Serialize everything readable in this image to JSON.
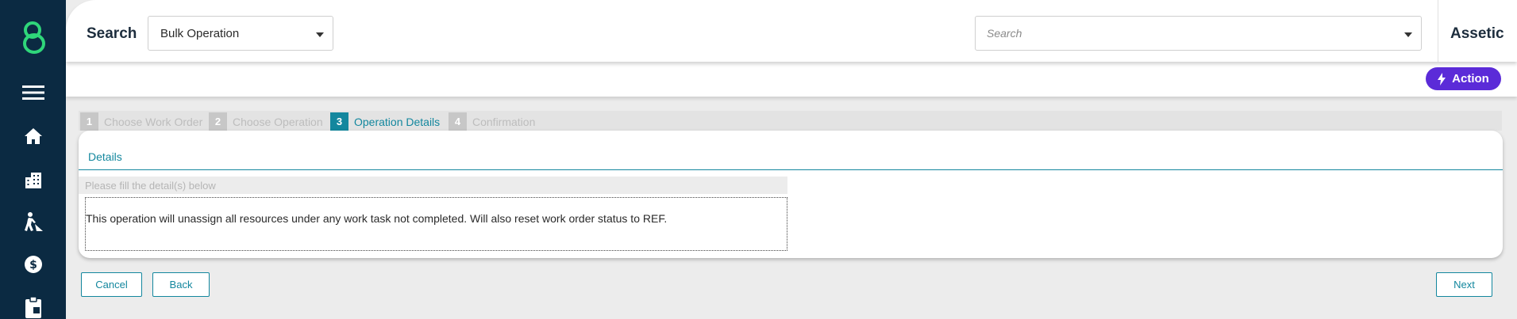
{
  "app": {
    "brand_name": "Assetic"
  },
  "header": {
    "title": "Search",
    "module_select": {
      "value": "Bulk Operation"
    },
    "search_select": {
      "placeholder": "Search"
    }
  },
  "sidebar": {
    "items": [
      {
        "icon": "menu-icon"
      },
      {
        "icon": "home-icon"
      },
      {
        "icon": "buildings-icon"
      },
      {
        "icon": "worker-icon"
      },
      {
        "icon": "finance-icon"
      },
      {
        "icon": "clipboard-icon"
      }
    ]
  },
  "action_bar": {
    "action_label": "Action",
    "action_icon": "lightning-icon"
  },
  "wizard": {
    "steps": [
      {
        "number": "1",
        "label": "Choose Work Order",
        "active": false
      },
      {
        "number": "2",
        "label": "Choose Operation",
        "active": false
      },
      {
        "number": "3",
        "label": "Operation Details",
        "active": true
      },
      {
        "number": "4",
        "label": "Confirmation",
        "active": false
      }
    ]
  },
  "details": {
    "title": "Details",
    "hint": "Please fill the detail(s) below",
    "message": "This operation will unassign all resources under any work task not completed. Will also reset work order status to REF."
  },
  "footer": {
    "cancel_label": "Cancel",
    "back_label": "Back",
    "next_label": "Next"
  },
  "colors": {
    "sidebar_bg": "#0b2a42",
    "logo": "#2fd67a",
    "accent": "#13879e",
    "action": "#5b2bd8"
  }
}
